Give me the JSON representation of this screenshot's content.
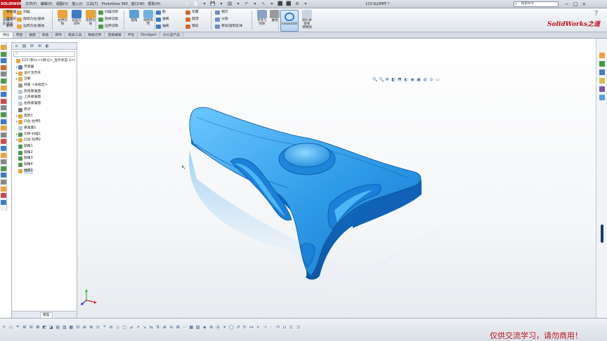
{
  "app": {
    "logo_text": "SOLIDWORKS",
    "doc_title": "123.SLDPRT *",
    "search_placeholder": "搜索命令",
    "brand_watermark": "SolidWorks之道",
    "help_symbol": "?",
    "window_controls": [
      "−",
      "□",
      "×"
    ]
  },
  "menu": [
    "文件(F)",
    "编辑(E)",
    "视图(V)",
    "插入(I)",
    "工具(T)",
    "PhotoView 360",
    "窗口(W)",
    "帮助(H)"
  ],
  "quick_access": [
    "⬜",
    "📄",
    "▾",
    "💾",
    "▾",
    "🖨",
    "▾",
    "↶",
    "▾",
    "↖",
    "▾",
    "⬛",
    "⬛",
    "⚙",
    "▾"
  ],
  "ribbon": {
    "big_buttons": [
      "旋转凸\n台/基体",
      "拉伸切\n除",
      "异型孔\n向导",
      "旋转切\n除",
      "圆角",
      "线性阵\n列",
      "参考几\n何体",
      "曲线"
    ],
    "small_items": [
      "扫描",
      "放样凸台/基体",
      "边界凸台/基体",
      "扫描切除",
      "放样切割",
      "边界切除",
      "筋",
      "拔模",
      "抽壳",
      "包覆",
      "圆顶",
      "镜向",
      "相交",
      "分割",
      "移动/复制实体",
      "移动面",
      "自由形",
      "删除"
    ],
    "instant3d": "Instant3D",
    "extra_button": "图片拼\n接和\n转换图"
  },
  "command_tabs": [
    "特征",
    "草图",
    "曲面",
    "钣金",
    "焊件",
    "模具工具",
    "数据迁移",
    "直接编辑",
    "评估",
    "DimXpert",
    "办公室产品"
  ],
  "feature_tree": {
    "filter_symbol": "▽",
    "items": [
      {
        "label": "123 (默认<<默认>_显示状态 1>)",
        "exp": ""
      },
      {
        "label": "传感器",
        "exp": "+"
      },
      {
        "label": "设计活页夹",
        "exp": "+"
      },
      {
        "label": "注解",
        "exp": "+"
      },
      {
        "label": "材质 <未指定>",
        "exp": ""
      },
      {
        "label": "前视基准面",
        "exp": ""
      },
      {
        "label": "上视基准面",
        "exp": ""
      },
      {
        "label": "右视基准面",
        "exp": ""
      },
      {
        "label": "原点",
        "exp": ""
      },
      {
        "label": "旋转1",
        "exp": "+"
      },
      {
        "label": "凸台-拉伸1",
        "exp": "+"
      },
      {
        "label": "基准面1",
        "exp": ""
      },
      {
        "label": "切除-扫描1",
        "exp": "+"
      },
      {
        "label": "凸台-拉伸2",
        "exp": "+"
      },
      {
        "label": "圆角1",
        "exp": ""
      },
      {
        "label": "圆角2",
        "exp": ""
      },
      {
        "label": "圆角3",
        "exp": ""
      },
      {
        "label": "圆角4",
        "exp": ""
      },
      {
        "label": "抽壳1",
        "exp": ""
      }
    ],
    "bottom_tab": "模型"
  },
  "hud_icons": [
    "🔍",
    "🔍",
    "✥",
    "◧",
    "⬒",
    "◐",
    "◉",
    "▣",
    "◍",
    "◎",
    "▭"
  ],
  "bottom_tools": [
    "↖",
    "▭",
    "⌗",
    "⊞",
    "⊟",
    "⊠",
    "◩",
    "◪",
    "▤",
    "▥",
    "▦",
    "⊡",
    "⊕",
    "⊗",
    "⊙",
    "⌖",
    "⊘",
    "◇",
    "▢",
    "⊿",
    "↗",
    "↘",
    "⇆",
    "⇅",
    "⊕",
    "⊖",
    "⊞",
    "⋯",
    "▦",
    "▧",
    "◈",
    "⊛",
    "⦿",
    "✕",
    "◯",
    "↺",
    "↻",
    "⊶",
    "⋄",
    "⊣",
    "◦",
    "⊓",
    "⊔",
    "⊏",
    "⊐"
  ],
  "notice": "仅供交流学习，请勿商用！",
  "colors": {
    "brand_red": "#c0141b",
    "model_blue": "#2e9be8",
    "accent_blue": "#2d7ed3"
  }
}
